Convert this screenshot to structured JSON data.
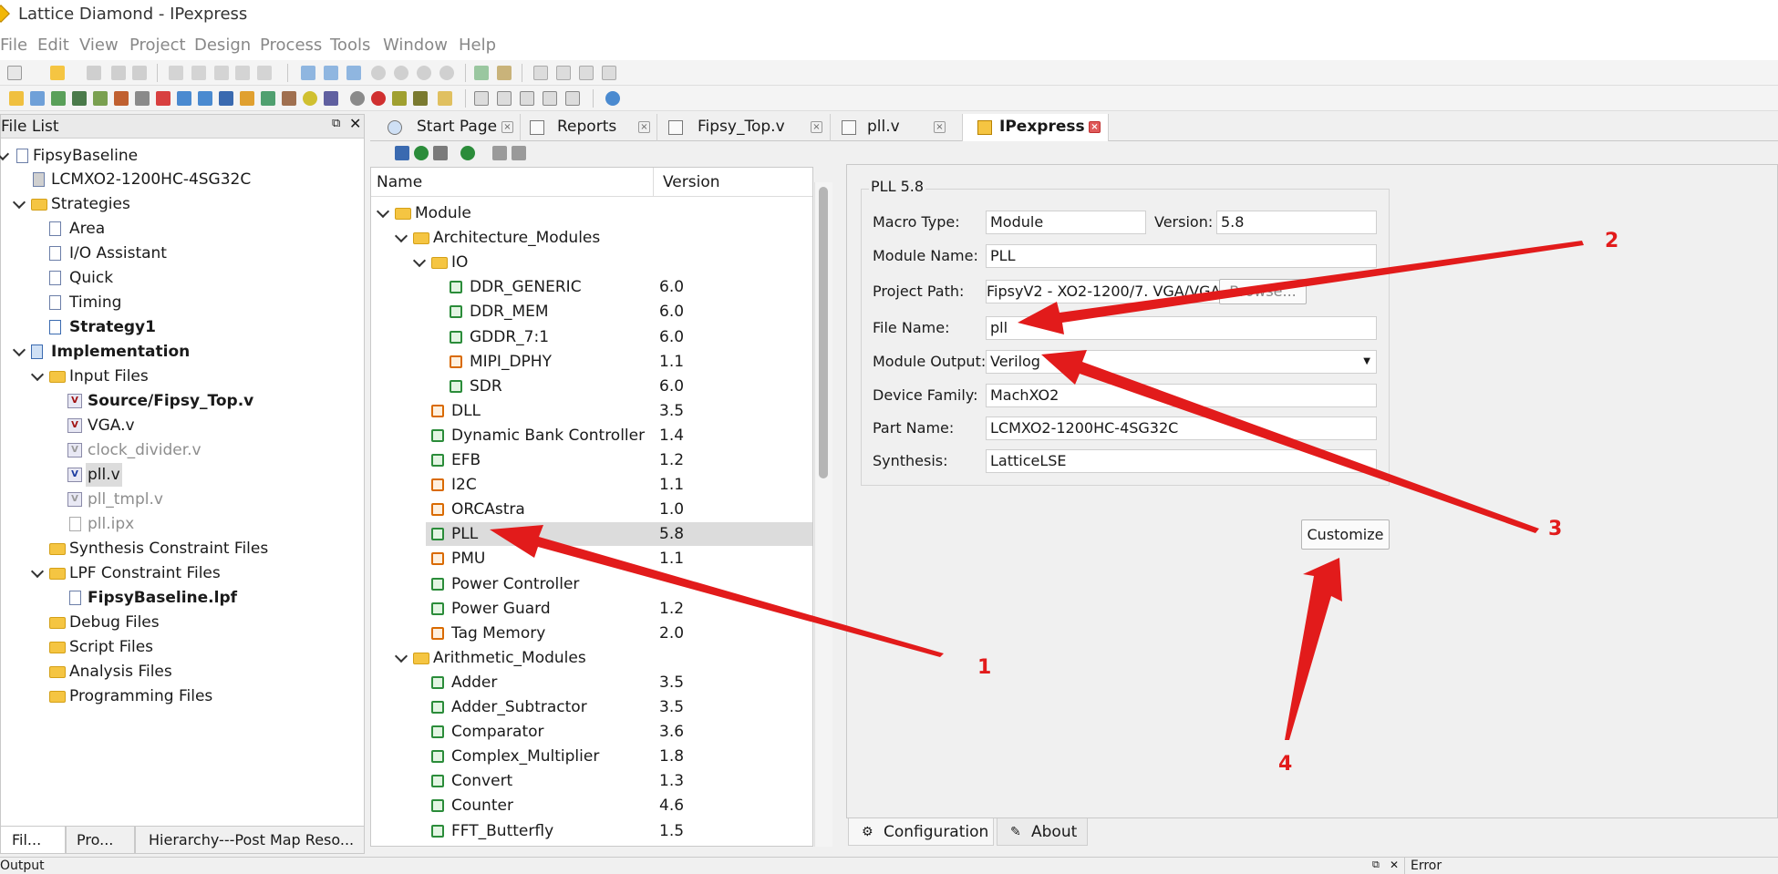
{
  "window": {
    "title": "Lattice Diamond - IPexpress"
  },
  "menu": [
    "File",
    "Edit",
    "View",
    "Project",
    "Design",
    "Process",
    "Tools",
    "Window",
    "Help"
  ],
  "file_list": {
    "title": "File List",
    "tree": [
      {
        "label": "FipsyBaseline",
        "icon": "project-icon"
      },
      {
        "label": "LCMXO2-1200HC-4SG32C",
        "icon": "device-icon"
      },
      {
        "label": "Strategies",
        "icon": "folder-icon"
      },
      {
        "label": "Area",
        "icon": "strategy-icon"
      },
      {
        "label": "I/O Assistant",
        "icon": "strategy-icon"
      },
      {
        "label": "Quick",
        "icon": "strategy-icon"
      },
      {
        "label": "Timing",
        "icon": "strategy-icon"
      },
      {
        "label": "Strategy1",
        "icon": "strategy-active-icon"
      },
      {
        "label": "Implementation",
        "icon": "implementation-icon"
      },
      {
        "label": "Input Files",
        "icon": "folder-icon"
      },
      {
        "label": "Source/Fipsy_Top.v",
        "icon": "verilog-file-icon"
      },
      {
        "label": "VGA.v",
        "icon": "verilog-file-icon"
      },
      {
        "label": "clock_divider.v",
        "icon": "verilog-file-icon"
      },
      {
        "label": "pll.v",
        "icon": "verilog-file-icon"
      },
      {
        "label": "pll_tmpl.v",
        "icon": "verilog-file-icon"
      },
      {
        "label": "pll.ipx",
        "icon": "ipx-file-icon"
      },
      {
        "label": "Synthesis Constraint Files",
        "icon": "folder-icon"
      },
      {
        "label": "LPF Constraint Files",
        "icon": "folder-icon"
      },
      {
        "label": "FipsyBaseline.lpf",
        "icon": "file-icon"
      },
      {
        "label": "Debug Files",
        "icon": "folder-icon"
      },
      {
        "label": "Script Files",
        "icon": "folder-icon"
      },
      {
        "label": "Analysis Files",
        "icon": "folder-icon"
      },
      {
        "label": "Programming Files",
        "icon": "folder-icon"
      }
    ],
    "bottom_tabs": [
      "Fil...",
      "Pro...",
      "Hierarchy---Post Map Reso..."
    ]
  },
  "editor_tabs": [
    {
      "label": "Start Page",
      "icon": "start-page-icon"
    },
    {
      "label": "Reports",
      "icon": "reports-icon"
    },
    {
      "label": "Fipsy_Top.v",
      "icon": "edit-file-icon"
    },
    {
      "label": "pll.v",
      "icon": "edit-file-icon"
    },
    {
      "label": "IPexpress",
      "icon": "ipexpress-icon",
      "active": true
    }
  ],
  "module_tree": {
    "col_name": "Name",
    "col_version": "Version",
    "rows": [
      {
        "name": "Module",
        "version": ""
      },
      {
        "name": "Architecture_Modules",
        "version": ""
      },
      {
        "name": "IO",
        "version": ""
      },
      {
        "name": "DDR_GENERIC",
        "version": "6.0"
      },
      {
        "name": "DDR_MEM",
        "version": "6.0"
      },
      {
        "name": "GDDR_7:1",
        "version": "6.0"
      },
      {
        "name": "MIPI_DPHY",
        "version": "1.1"
      },
      {
        "name": "SDR",
        "version": "6.0"
      },
      {
        "name": "DLL",
        "version": "3.5"
      },
      {
        "name": "Dynamic Bank Controller",
        "version": "1.4"
      },
      {
        "name": "EFB",
        "version": "1.2"
      },
      {
        "name": "I2C",
        "version": "1.1"
      },
      {
        "name": "ORCAstra",
        "version": "1.0"
      },
      {
        "name": "PLL",
        "version": "5.8"
      },
      {
        "name": "PMU",
        "version": "1.1"
      },
      {
        "name": "Power Controller",
        "version": ""
      },
      {
        "name": "Power Guard",
        "version": "1.2"
      },
      {
        "name": "Tag Memory",
        "version": "2.0"
      },
      {
        "name": "Arithmetic_Modules",
        "version": ""
      },
      {
        "name": "Adder",
        "version": "3.5"
      },
      {
        "name": "Adder_Subtractor",
        "version": "3.5"
      },
      {
        "name": "Comparator",
        "version": "3.6"
      },
      {
        "name": "Complex_Multiplier",
        "version": "1.8"
      },
      {
        "name": "Convert",
        "version": "1.3"
      },
      {
        "name": "Counter",
        "version": "4.6"
      },
      {
        "name": "FFT_Butterfly",
        "version": "1.5"
      }
    ]
  },
  "form": {
    "group_title": "PLL 5.8",
    "macro_type_label": "Macro Type:",
    "macro_type_value": "Module",
    "version_label": "Version:",
    "version_value": "5.8",
    "module_name_label": "Module Name:",
    "module_name_value": "PLL",
    "project_path_label": "Project Path:",
    "project_path_value": "FipsyV2 - XO2-1200/7. VGA/VGA",
    "browse_label": "Browse...",
    "file_name_label": "File Name:",
    "file_name_value": "pll",
    "module_output_label": "Module Output:",
    "module_output_value": "Verilog",
    "device_family_label": "Device Family:",
    "device_family_value": "MachXO2",
    "part_name_label": "Part Name:",
    "part_name_value": "LCMXO2-1200HC-4SG32C",
    "synthesis_label": "Synthesis:",
    "synthesis_value": "LatticeLSE",
    "customize_label": "Customize"
  },
  "right_tabs": [
    "Configuration",
    "About"
  ],
  "output_strip": {
    "left": "Output",
    "right": "Error"
  },
  "annotations": [
    "1",
    "2",
    "3",
    "4"
  ],
  "colors": {
    "annotation": "#e21b1b",
    "selection": "#dcdcdc",
    "chip_green": "#2b8c3a",
    "chip_orange": "#d96a00"
  }
}
